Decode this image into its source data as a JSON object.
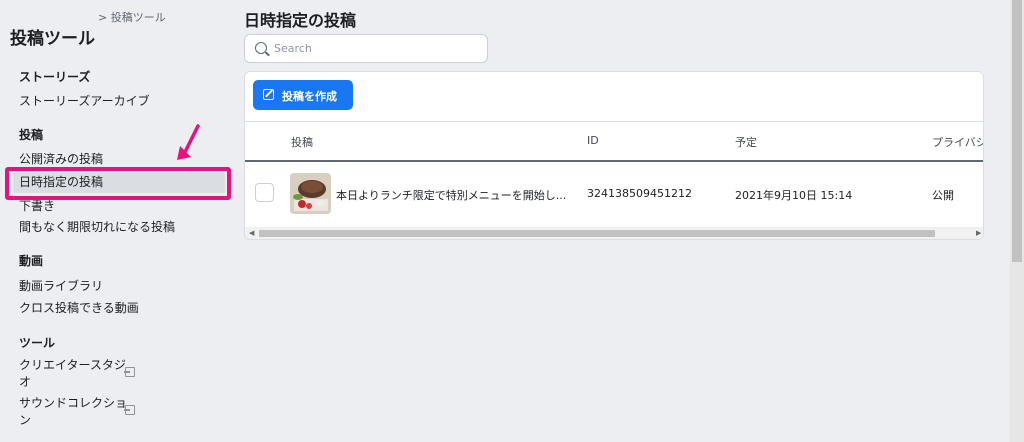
{
  "sidebar": {
    "breadcrumb": "> 投稿ツール",
    "title": "投稿ツール",
    "sections": {
      "stories": {
        "heading": "ストーリーズ",
        "items": [
          "ストーリーズアーカイブ"
        ]
      },
      "posts": {
        "heading": "投稿",
        "items": [
          "公開済みの投稿",
          "日時指定の投稿",
          "下書き",
          "間もなく期限切れになる投稿"
        ]
      },
      "videos": {
        "heading": "動画",
        "items": [
          "動画ライブラリ",
          "クロス投稿できる動画"
        ]
      },
      "tools": {
        "heading": "ツール",
        "items": [
          "クリエイタースタジオ",
          "サウンドコレクション"
        ]
      }
    },
    "highlight_color": "#e8117f"
  },
  "main": {
    "title": "日時指定の投稿",
    "search": {
      "placeholder": "Search"
    },
    "create_button": "投稿を作成",
    "accent": "#1877f2",
    "table": {
      "columns": [
        "投稿",
        "ID",
        "予定",
        "プライバシ"
      ],
      "rows": [
        {
          "post": "本日よりランチ限定で特別メニューを開始し...",
          "id": "324138509451212",
          "scheduled": "2021年9月10日 15:14",
          "privacy": "公開"
        }
      ]
    }
  }
}
